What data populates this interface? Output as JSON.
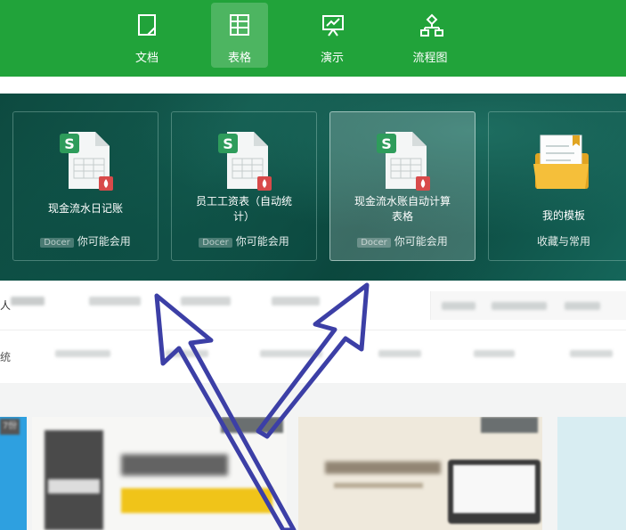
{
  "nav": {
    "items": [
      {
        "label": "文档"
      },
      {
        "label": "表格"
      },
      {
        "label": "演示"
      },
      {
        "label": "流程图"
      }
    ],
    "active_index": 1
  },
  "banner": {
    "cards": [
      {
        "title": "现金流水日记账",
        "tag": "Docer",
        "sub": "你可能会用"
      },
      {
        "title": "员工工资表（自动统计）",
        "tag": "Docer",
        "sub": "你可能会用"
      },
      {
        "title": "现金流水账自动计算表格",
        "tag": "Docer",
        "sub": "你可能会用"
      },
      {
        "title": "我的模板",
        "sub": "收藏与常用"
      }
    ]
  },
  "categories": {
    "first": "人",
    "second_first": "统",
    "badge_left": "7份"
  },
  "colors": {
    "brand_green": "#21a33a",
    "banner_teal": "#0f4f45",
    "arrow_blue": "#3c3fa6"
  }
}
